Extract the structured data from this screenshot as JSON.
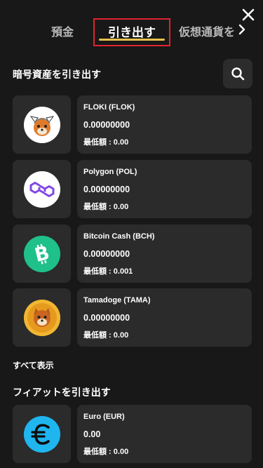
{
  "tabs": {
    "deposit": "預金",
    "withdraw": "引き出す",
    "crypto": "仮想通貨を"
  },
  "crypto_section": {
    "title": "暗号資産を引き出す",
    "items": [
      {
        "name": "FLOKI (FLOK)",
        "amount": "0.00000000",
        "min": "最低額 : 0.00",
        "icon": "floki-icon"
      },
      {
        "name": "Polygon (POL)",
        "amount": "0.00000000",
        "min": "最低額 : 0.00",
        "icon": "polygon-icon"
      },
      {
        "name": "Bitcoin Cash (BCH)",
        "amount": "0.00000000",
        "min": "最低額 : 0.001",
        "icon": "bitcoin-cash-icon"
      },
      {
        "name": "Tamadoge (TAMA)",
        "amount": "0.00000000",
        "min": "最低額 : 0.00",
        "icon": "tamadoge-icon"
      }
    ],
    "show_all": "すべて表示"
  },
  "fiat_section": {
    "title": "フィアットを引き出す",
    "items": [
      {
        "name": "Euro (EUR)",
        "amount": "0.00",
        "min": "最低額 : 0.00",
        "icon": "euro-icon"
      }
    ]
  },
  "colors": {
    "background": "#181818",
    "card": "#2b2b2b",
    "active_tab_border": "#e0242f",
    "active_tab_underline": "#e8c14a",
    "polygon": "#8247e5",
    "bitcoin_cash": "#1fc08a",
    "euro": "#1fb5ef",
    "floki": "#e07a2a",
    "tamadoge": "#e8a92a"
  }
}
